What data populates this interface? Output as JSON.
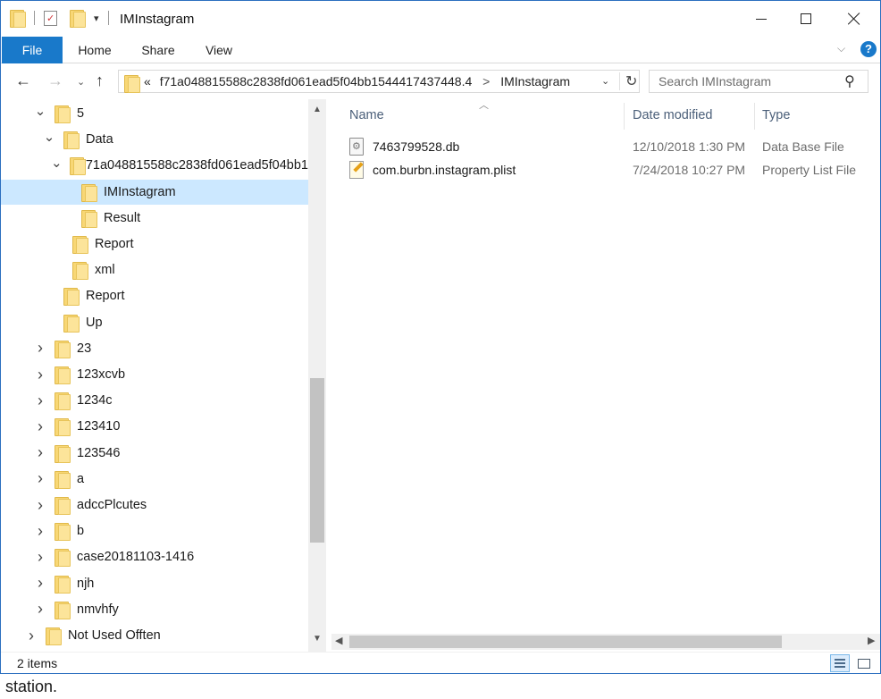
{
  "window": {
    "title": "IMInstagram"
  },
  "ribbon": {
    "tabs": [
      "File",
      "Home",
      "Share",
      "View"
    ]
  },
  "address": {
    "overflow": "«",
    "segments": [
      "f71a048815588c2838fd061ead5f04bb1544417437448.4",
      "IMInstagram"
    ]
  },
  "search": {
    "placeholder": "Search IMInstagram"
  },
  "tree": [
    {
      "label": "5",
      "depth": 0,
      "state": "expanded"
    },
    {
      "label": "Data",
      "depth": 1,
      "state": "expanded"
    },
    {
      "label": "f71a048815588c2838fd061ead5f04bb1",
      "depth": 2,
      "state": "expanded"
    },
    {
      "label": "IMInstagram",
      "depth": 3,
      "state": "none",
      "selected": true
    },
    {
      "label": "Result",
      "depth": 3,
      "state": "none"
    },
    {
      "label": "Report",
      "depth": 2,
      "state": "none"
    },
    {
      "label": "xml",
      "depth": 2,
      "state": "none"
    },
    {
      "label": "Report",
      "depth": 1,
      "state": "none"
    },
    {
      "label": "Up",
      "depth": 1,
      "state": "none"
    },
    {
      "label": "23",
      "depth": 0,
      "state": "collapsed"
    },
    {
      "label": "123xcvb",
      "depth": 0,
      "state": "collapsed"
    },
    {
      "label": "1234c",
      "depth": 0,
      "state": "collapsed"
    },
    {
      "label": "123410",
      "depth": 0,
      "state": "collapsed"
    },
    {
      "label": "123546",
      "depth": 0,
      "state": "collapsed"
    },
    {
      "label": "a",
      "depth": 0,
      "state": "collapsed"
    },
    {
      "label": "adccPlcutes",
      "depth": 0,
      "state": "collapsed"
    },
    {
      "label": "b",
      "depth": 0,
      "state": "collapsed"
    },
    {
      "label": "case20181103-1416",
      "depth": 0,
      "state": "collapsed"
    },
    {
      "label": "njh",
      "depth": 0,
      "state": "collapsed"
    },
    {
      "label": "nmvhfy",
      "depth": 0,
      "state": "collapsed"
    },
    {
      "label": "Not Used Offten",
      "depth": -1,
      "state": "collapsed"
    }
  ],
  "columns": {
    "name": "Name",
    "date": "Date modified",
    "type": "Type"
  },
  "files": [
    {
      "name": "7463799528.db",
      "date": "12/10/2018 1:30 PM",
      "type": "Data Base File",
      "icon": "database-file-icon"
    },
    {
      "name": "com.burbn.instagram.plist",
      "date": "7/24/2018 10:27 PM",
      "type": "Property List File",
      "icon": "plist-file-icon"
    }
  ],
  "status": {
    "count": "2 items"
  },
  "caption": "station."
}
